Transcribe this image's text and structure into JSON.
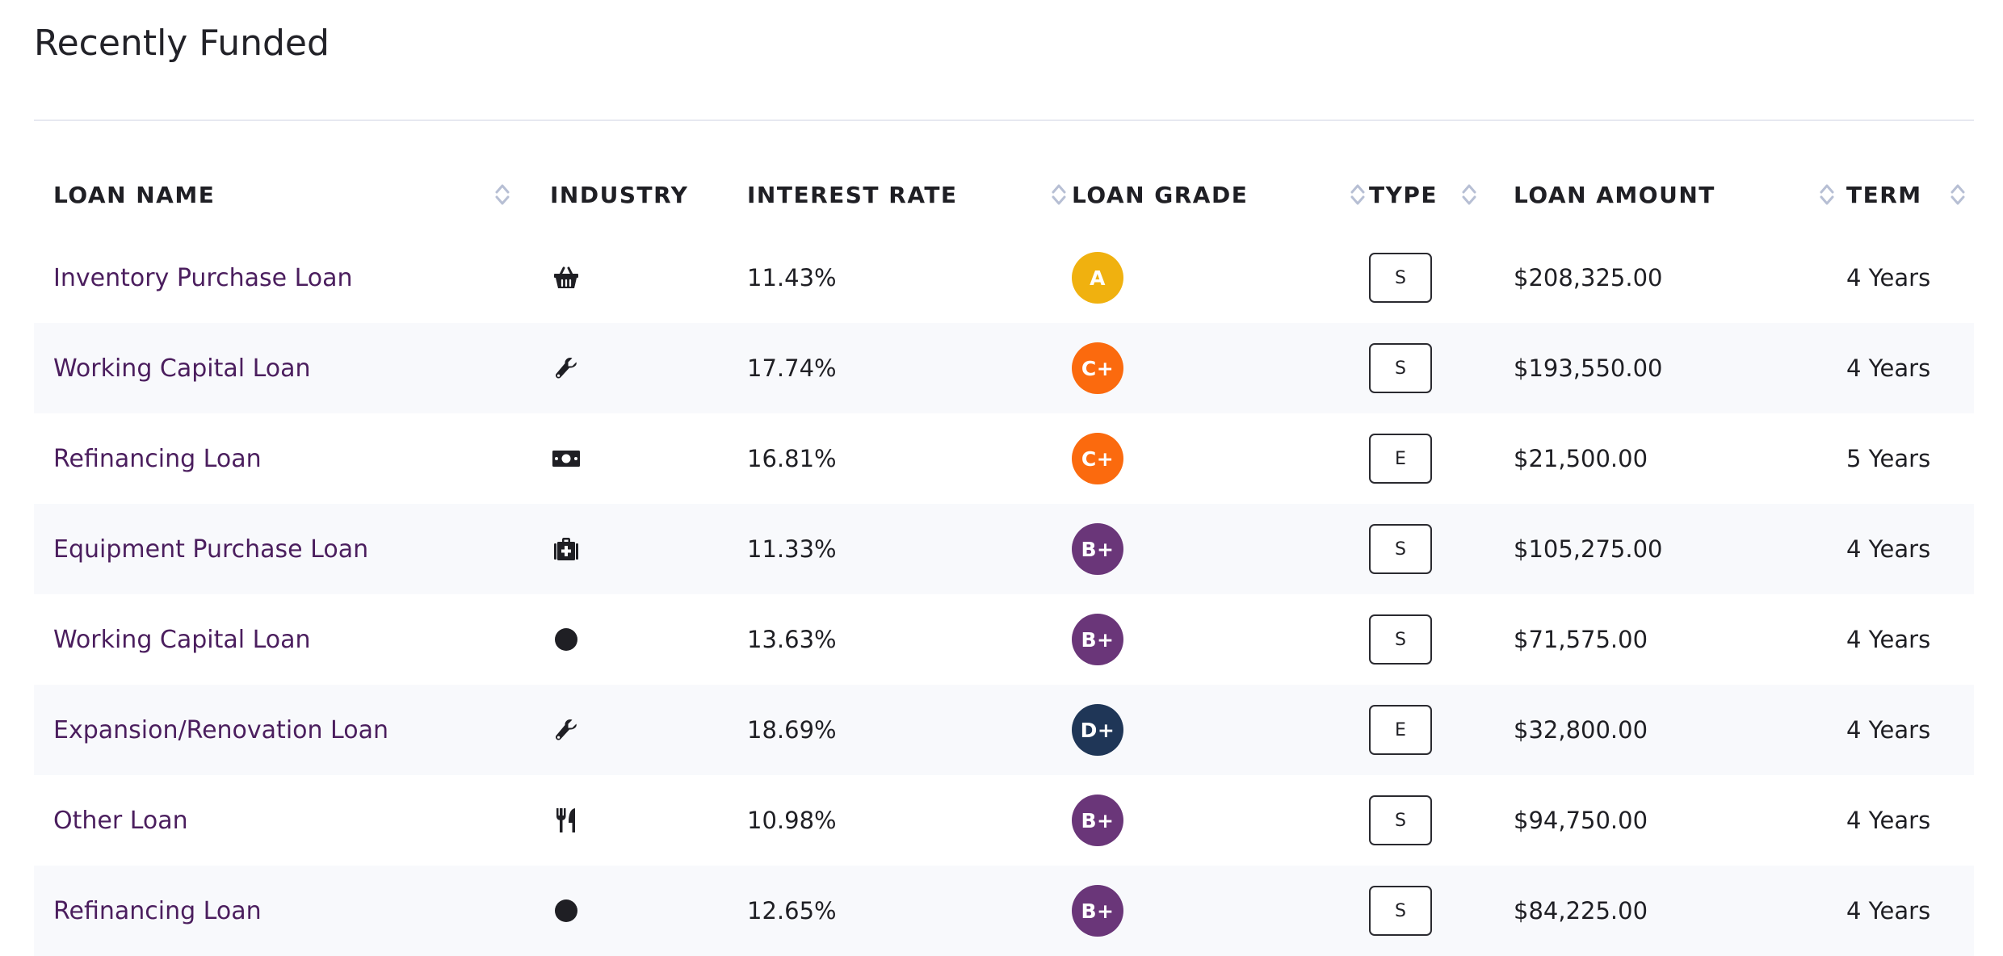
{
  "page": {
    "title": "Recently Funded"
  },
  "table": {
    "columns": [
      {
        "key": "loan_name",
        "label": "LOAN NAME",
        "sortable": true
      },
      {
        "key": "industry",
        "label": "INDUSTRY",
        "sortable": false
      },
      {
        "key": "interest_rate",
        "label": "INTEREST RATE",
        "sortable": true
      },
      {
        "key": "loan_grade",
        "label": "LOAN GRADE",
        "sortable": true
      },
      {
        "key": "type",
        "label": "TYPE",
        "sortable": true
      },
      {
        "key": "loan_amount",
        "label": "LOAN AMOUNT",
        "sortable": true
      },
      {
        "key": "term",
        "label": "TERM",
        "sortable": true
      }
    ],
    "rows": [
      {
        "loan_name": "Inventory Purchase Loan",
        "industry_icon": "shopping-basket-icon",
        "interest_rate": "11.43%",
        "loan_grade": "A",
        "grade_color": "#f0b10f",
        "type": "S",
        "loan_amount": "$208,325.00",
        "term": "4 Years"
      },
      {
        "loan_name": "Working Capital Loan",
        "industry_icon": "wrench-icon",
        "interest_rate": "17.74%",
        "loan_grade": "C+",
        "grade_color": "#fb6a0e",
        "type": "S",
        "loan_amount": "$193,550.00",
        "term": "4 Years"
      },
      {
        "loan_name": "Refinancing Loan",
        "industry_icon": "money-bill-icon",
        "interest_rate": "16.81%",
        "loan_grade": "C+",
        "grade_color": "#fb6a0e",
        "type": "E",
        "loan_amount": "$21,500.00",
        "term": "5 Years"
      },
      {
        "loan_name": "Equipment Purchase Loan",
        "industry_icon": "medical-kit-icon",
        "interest_rate": "11.33%",
        "loan_grade": "B+",
        "grade_color": "#6a3679",
        "type": "S",
        "loan_amount": "$105,275.00",
        "term": "4 Years"
      },
      {
        "loan_name": "Working Capital Loan",
        "industry_icon": "circle-icon",
        "interest_rate": "13.63%",
        "loan_grade": "B+",
        "grade_color": "#6a3679",
        "type": "S",
        "loan_amount": "$71,575.00",
        "term": "4 Years"
      },
      {
        "loan_name": "Expansion/Renovation Loan",
        "industry_icon": "wrench-icon",
        "interest_rate": "18.69%",
        "loan_grade": "D+",
        "grade_color": "#1f3657",
        "type": "E",
        "loan_amount": "$32,800.00",
        "term": "4 Years"
      },
      {
        "loan_name": "Other Loan",
        "industry_icon": "utensils-icon",
        "interest_rate": "10.98%",
        "loan_grade": "B+",
        "grade_color": "#6a3679",
        "type": "S",
        "loan_amount": "$94,750.00",
        "term": "4 Years"
      },
      {
        "loan_name": "Refinancing Loan",
        "industry_icon": "circle-icon",
        "interest_rate": "12.65%",
        "loan_grade": "B+",
        "grade_color": "#6a3679",
        "type": "S",
        "loan_amount": "$84,225.00",
        "term": "4 Years"
      }
    ]
  },
  "colors": {
    "loan_name_link": "#4b1e5e",
    "row_stripe": "#f8f9fc",
    "sort_icon": "#b7bfd4"
  }
}
